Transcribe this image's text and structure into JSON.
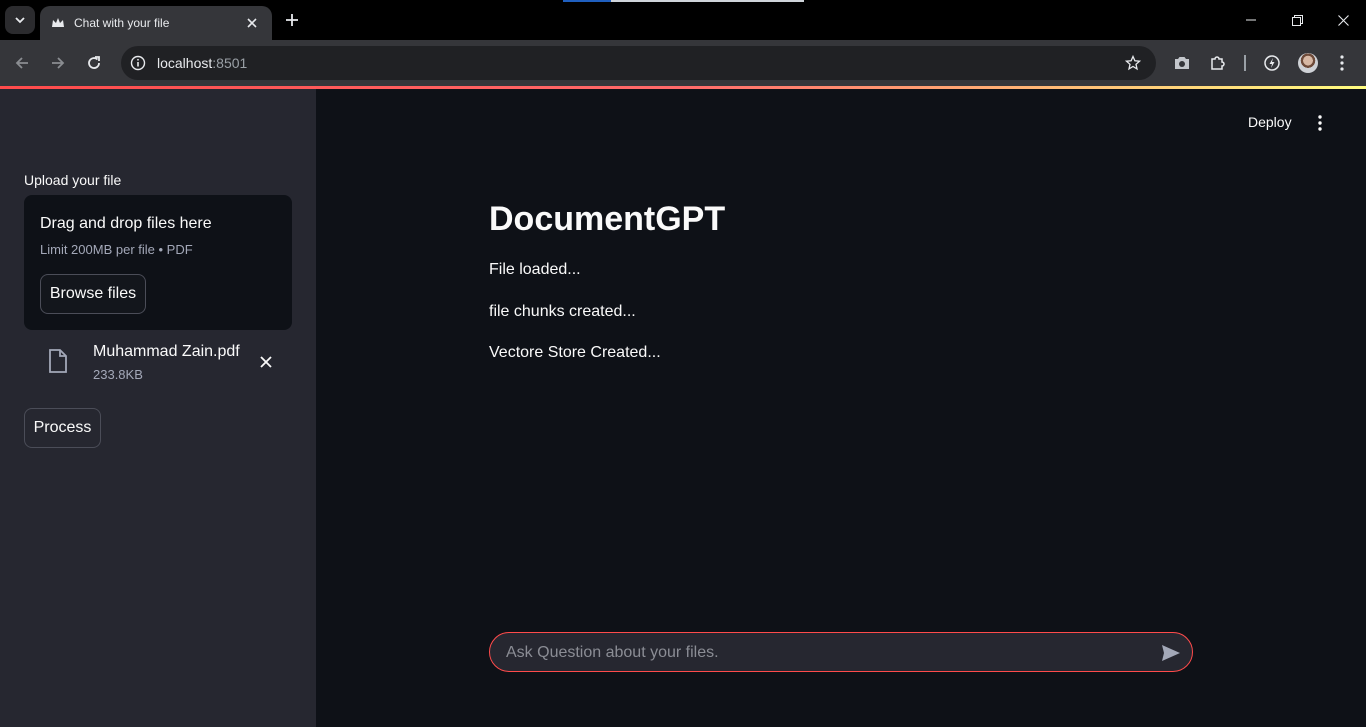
{
  "browser": {
    "tab_title": "Chat with your file",
    "url_host": "localhost",
    "url_port": ":8501"
  },
  "header": {
    "deploy_label": "Deploy"
  },
  "sidebar": {
    "upload_label": "Upload your file",
    "dropzone_title": "Drag and drop files here",
    "dropzone_limit": "Limit 200MB per file • PDF",
    "browse_label": "Browse files",
    "file": {
      "name": "Muhammad Zain.pdf",
      "size": "233.8KB"
    },
    "process_label": "Process"
  },
  "main": {
    "title": "DocumentGPT",
    "status_messages": [
      "File loaded...",
      "file chunks created...",
      "Vectore Store Created..."
    ],
    "chat_placeholder": "Ask Question about your files."
  },
  "colors": {
    "accent": "#ff4b4b",
    "sidebar_bg": "#262730",
    "main_bg": "#0e1117"
  }
}
